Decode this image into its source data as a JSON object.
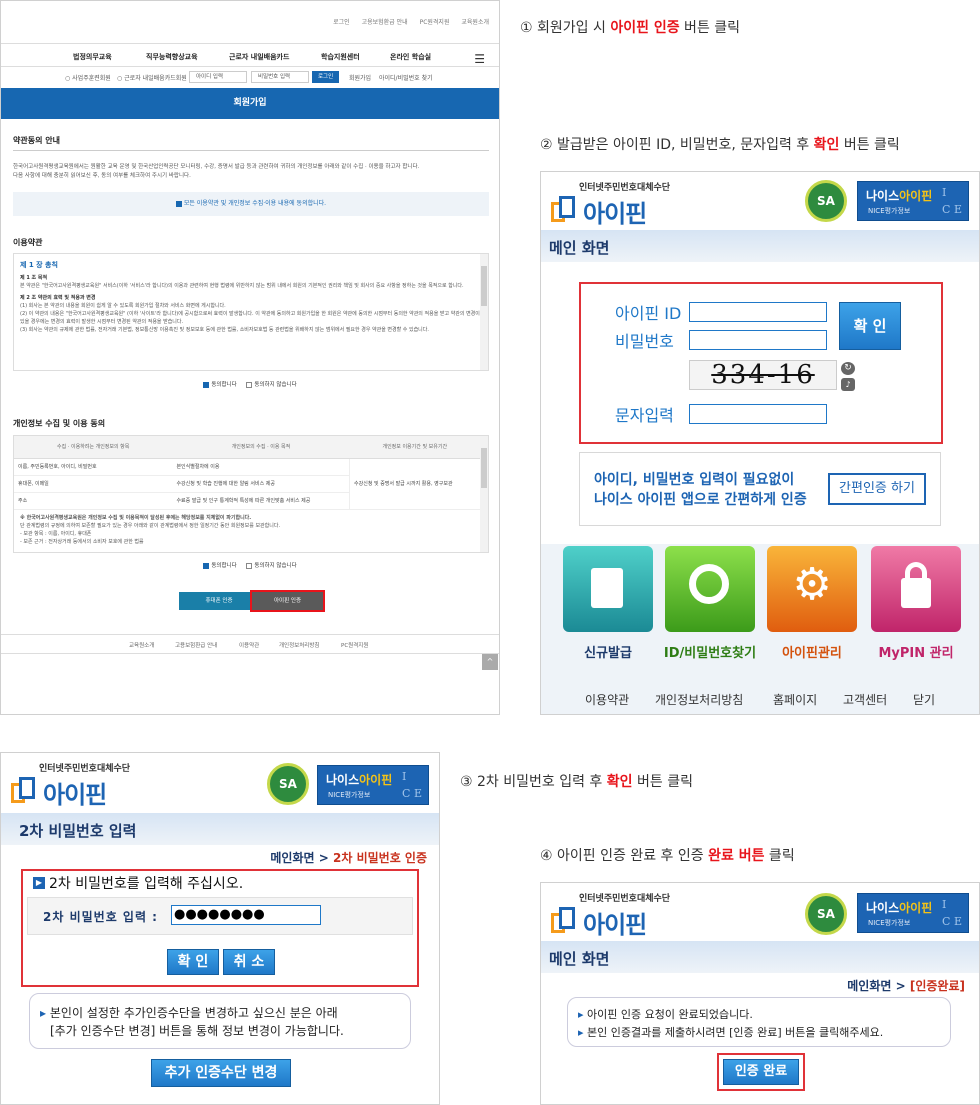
{
  "steps": {
    "s1": {
      "num": "①",
      "pre": "회원가입 시 ",
      "hl": "아이핀 인증",
      "post": " 버튼 클릭"
    },
    "s2": {
      "num": "②",
      "pre": "발급받은 아이핀 ID, 비밀번호, 문자입력 후 ",
      "hl": "확인",
      "post": " 버튼 클릭"
    },
    "s3": {
      "num": "③",
      "pre": "2차 비밀번호 입력 후 ",
      "hl": "확인",
      "post": " 버튼 클릭"
    },
    "s4": {
      "num": "④",
      "pre": "아이핀 인증 완료 후 인증 ",
      "hl": "완료 버튼",
      "post": " 클릭"
    }
  },
  "site": {
    "toplinks": [
      "로그인",
      "고용보험환급 안내",
      "PC원격지원",
      "교육원소개"
    ],
    "gnb": [
      "법정의무교육",
      "직무능력향상교육",
      "근로자 내일배움카드",
      "학습지원센터",
      "온라인 학습실"
    ],
    "subbar": {
      "radio1": "사업주훈련회원",
      "radio2": "근로자 내일배움카드회원",
      "id_ph": "아이디 입력",
      "pw_ph": "비밀번호 입력",
      "login": "로그인",
      "join": "회원가입",
      "find": "아이디/비밀번호 찾기"
    },
    "banner": "회원가입",
    "guide_title": "약관동의 안내",
    "guide_text1": "한국어고사원격평생교육원에서는 원활한 교육 운영 및 한국산업인력공단 모니터링, 수강, 증명서 발급 등과 관련하여 귀하의 개인정보를 아래와 같이 수집 · 이용을 하고자 합니다.",
    "guide_text2": "다음 사항에 대해 충분히 읽어보신 후, 동의 여부를 체크하여 주시기 바랍니다.",
    "agree_all": "모든 이용약관 및 개인정보 수집·이용 내용에 동의합니다.",
    "terms_title": "이용약관",
    "terms": {
      "chapter": "제 1 장 총칙",
      "a1": "제 1 조 목적",
      "a1t": "본 약관은 \"한국어고사원격평생교육원\" 서비스(이하 '서비스'라 합니다)의 이용과 관련하여 현행 법령에 위반하지 않는 범위 내에서 회원의 기본적인 권리와 책임 및 회사의 중요 사항을 정하는 것을 목적으로 합니다.",
      "a2": "제 2 조 약관의 효력 및 적용과 변경",
      "a2t1": "(1) 회사는 본 약관의 내용을 회원이 쉽게 알 수 있도록 회원가입 절차와 서비스 화면에 게시합니다.",
      "a2t2": "(2) 이 약관의 내용은 \"한국어고사원격평생교육원\" (이하 '사이트'라 합니다)에 공시함으로써 효력이 발생합니다. 이 약관에 동의하고 회원가입을 한 회원은 약관에 동의한 시점부터 동의한 약관의 적용을 받고 약관의 변경이 있을 경우에는 변경의 효력이 발생한 시점부터 변경된 약관의 적용을 받습니다.",
      "a2t3": "(3) 회사는 약관의 규제에 관한 법률, 전자거래 기본법, 정보통신망 이용촉진 및 정보보호 등에 관한 법률, 소비자보호법 등 관련법을 위배하지 않는 범위에서 필요한 경우 약관을 변경할 수 있습니다."
    },
    "agree": "동의합니다",
    "disagree": "동의하지 않습니다",
    "priv_title": "개인정보 수집 및 이용 동의",
    "priv_headers": [
      "수집 · 이용하려는 개인정보의 항목",
      "개인정보의 수집 · 이용 목적",
      "개인정보 이용기간 및 보유기간"
    ],
    "priv_rows": [
      [
        "이름, 주민등록번호, 아이디, 비밀번호",
        "본인식별절차에 이용",
        ""
      ],
      [
        "휴대폰, 이메일",
        "수강신청 및 학습 진행에 대한 알림 서비스 제공",
        "수강신청 및 증명서 발급 시까지 활용, 영구보관"
      ],
      [
        "주소",
        "수료증 발급 및 인구 통계학적 특성에 따른 개인맞춤 서비스 제공",
        ""
      ]
    ],
    "priv_note1": "※ 한국어고사원격평생교육원은 개인정보 수집 및 이용목적이 달성된 후에는 해당정보를 지체없이 파기합니다.",
    "priv_note2": "단 관계법령의 규정에 의하여 보존할 필요가 있는 경우 아래와 같이 관계법령에서 정한 일정기간 동안 회원정보를 보관합니다.",
    "priv_note3": "- 보관 항목 : 이름, 아이디, 휴대폰",
    "priv_note4": "- 보존 근거 : 전자상거래 등에서의 소비자 보호에 관한 법률",
    "btn_phone": "휴대폰 인증",
    "btn_ipin": "아이핀 인증",
    "footer": [
      "교육원소개",
      "고용보험환급 안내",
      "이용약관",
      "개인정보처리방침",
      "PC원격지원"
    ],
    "to_top": "^"
  },
  "ipin_brand": {
    "small": "인터넷주민번호대체수단",
    "name": "아이핀",
    "sa": "SA",
    "nice1": "나이스",
    "nice1b": "아이핀",
    "nice2": "NICE평가정보",
    "ice": "I\nC E"
  },
  "ipin_main": {
    "title": "메인 화면",
    "id_label": "아이핀 ID",
    "pw_label": "비밀번호",
    "captcha_text": "334-16",
    "char_label": "문자입력",
    "confirm": "확 인",
    "easy_text1": "아이디, 비밀번호 입력이 필요없이",
    "easy_text2": "나이스 아이핀 앱으로 간편하게 인증",
    "easy_btn": "간편인증 하기",
    "tiles": [
      "신규발급",
      "ID/비밀번호찾기",
      "아이핀관리",
      "MyPIN 관리"
    ],
    "bottom_links": [
      "이용약관",
      "개인정보처리방침",
      "홈페이지",
      "고객센터",
      "닫기"
    ]
  },
  "ipin_second": {
    "title": "2차 비밀번호 입력",
    "crumb_home": "메인화면",
    "crumb_sep": ">",
    "crumb_cur": "2차 비밀번호 인증",
    "prompt": "2차 비밀번호를 입력해 주십시오.",
    "pw_label": "2차 비밀번호 입력 :",
    "pw_value": "●●●●●●●●",
    "ok": "확 인",
    "cancel": "취 소",
    "note1": "본인이 설정한 추가인증수단을 변경하고 싶으신 분은 아래",
    "note2": "[추가 인증수단 변경] 버튼을 통해 정보 변경이 가능합니다.",
    "change_btn": "추가 인증수단 변경"
  },
  "ipin_done": {
    "title": "메인 화면",
    "crumb_home": "메인화면",
    "crumb_sep": ">",
    "crumb_cur": "[인증완료]",
    "msg1": "아이핀 인증 요청이 완료되었습니다.",
    "msg2": "본인 인증결과를 제출하시려면 [인증 완료] 버튼을 클릭해주세요.",
    "done_btn": "인증 완료"
  },
  "colors": {
    "accent_red": "#e8141b",
    "site_blue": "#1767b1",
    "ipin_blue": "#1d64b3"
  }
}
